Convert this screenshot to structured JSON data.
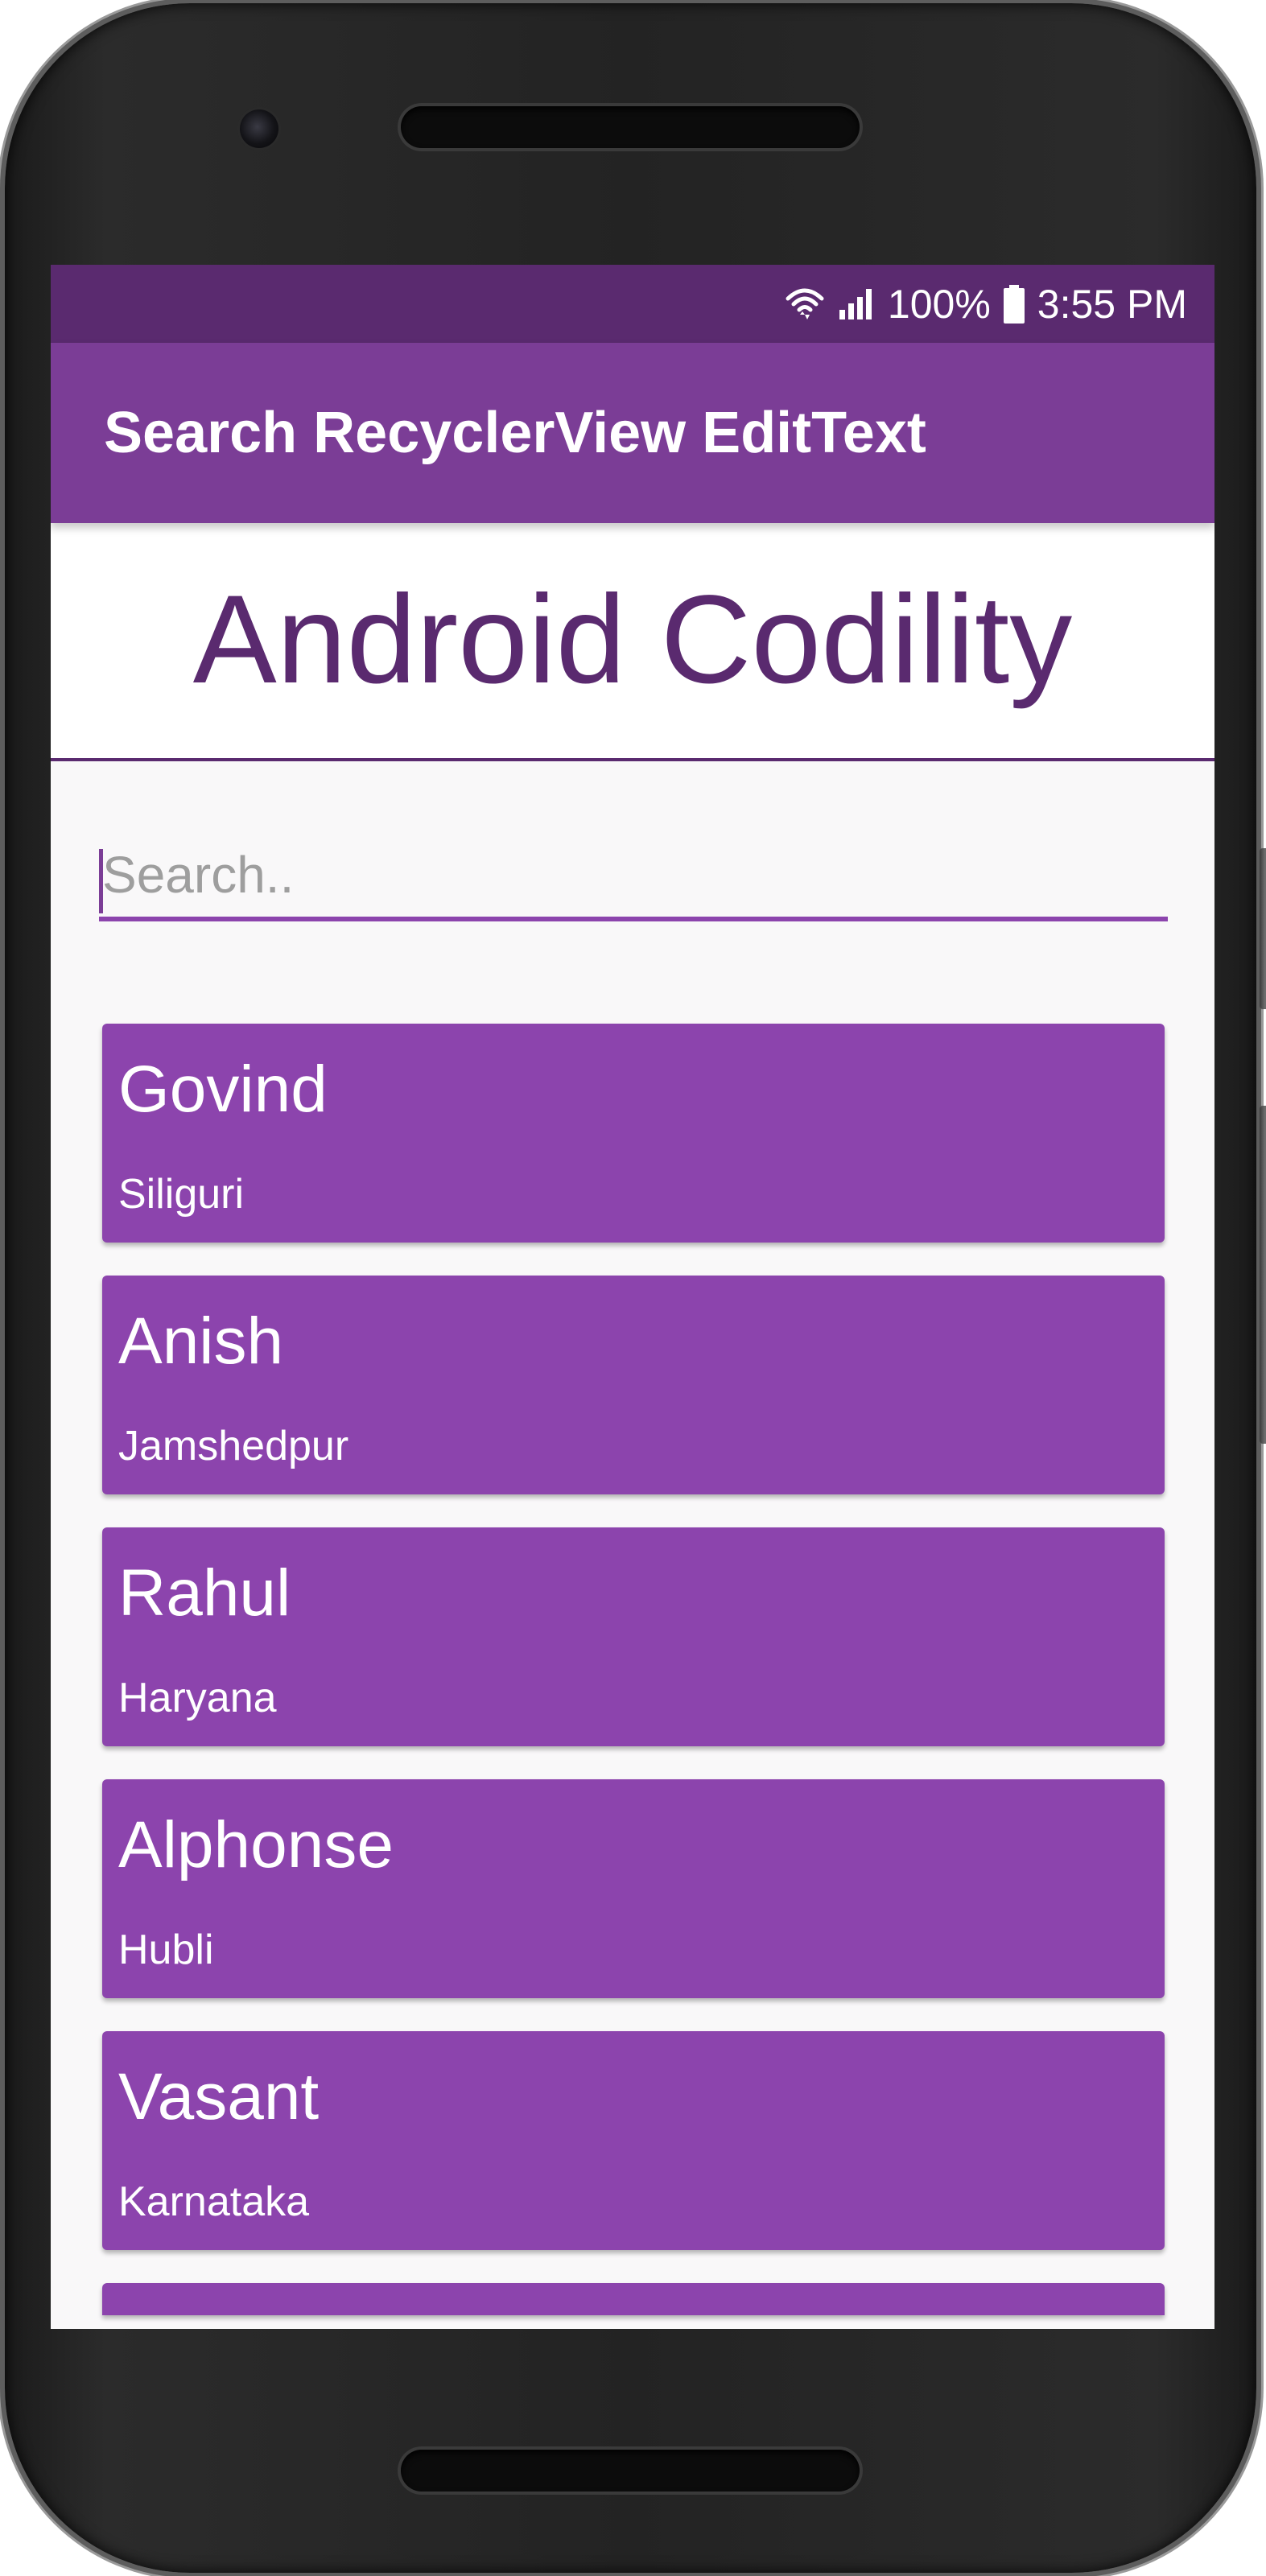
{
  "status_bar": {
    "battery": "100%",
    "time": "3:55 PM"
  },
  "app_bar": {
    "title": "Search RecyclerView EditText"
  },
  "header": {
    "brand": "Android Codility"
  },
  "search": {
    "placeholder": "Search..",
    "value": ""
  },
  "list": {
    "items": [
      {
        "name": "Govind",
        "city": "Siliguri"
      },
      {
        "name": "Anish",
        "city": "Jamshedpur"
      },
      {
        "name": "Rahul",
        "city": "Haryana"
      },
      {
        "name": "Alphonse",
        "city": "Hubli"
      },
      {
        "name": "Vasant",
        "city": "Karnataka"
      }
    ]
  },
  "colors": {
    "status_bar": "#5a2a6f",
    "app_bar": "#7b3d96",
    "card": "#8c44ad",
    "brand_text": "#5a2a6f",
    "screen_bg": "#f9f8f9"
  },
  "icons": [
    "wifi-icon",
    "cell-signal-icon",
    "battery-icon"
  ]
}
